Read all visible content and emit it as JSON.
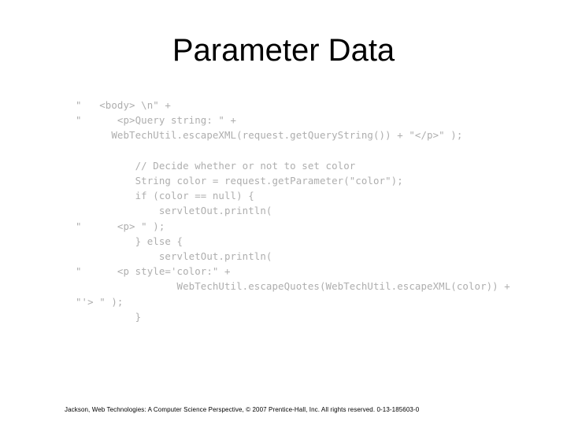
{
  "slide": {
    "title": "Parameter Data",
    "code_lines": [
      "\"   <body> \\n\" +",
      "\"      <p>Query string: \" +",
      "      WebTechUtil.escapeXML(request.getQueryString()) + \"</p>\" );",
      "",
      "          // Decide whether or not to set color",
      "          String color = request.getParameter(\"color\");",
      "          if (color == null) {",
      "              servletOut.println(",
      "\"      <p> \" );",
      "          } else {",
      "              servletOut.println(",
      "\"      <p style='color:\" +",
      "                 WebTechUtil.escapeQuotes(WebTechUtil.escapeXML(color)) +",
      "\"'> \" );",
      "          }"
    ],
    "footer": "Jackson, Web Technologies: A Computer Science Perspective, © 2007 Prentice-Hall, Inc. All rights reserved. 0-13-185603-0"
  },
  "colors": {
    "background": "#ffffff",
    "title_text": "#000000",
    "code_text": "#aeaeae",
    "footer_text": "#000000"
  }
}
